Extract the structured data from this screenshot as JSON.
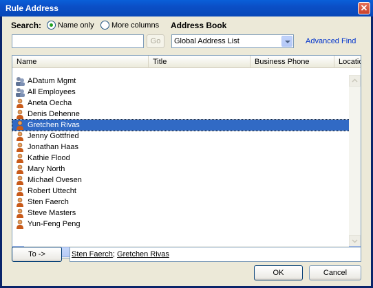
{
  "window": {
    "title": "Rule Address"
  },
  "search": {
    "label": "Search:",
    "options": [
      {
        "label": "Name only",
        "selected": true
      },
      {
        "label": "More columns",
        "selected": false
      }
    ],
    "input_value": "",
    "go_label": "Go"
  },
  "address_book": {
    "label": "Address Book",
    "selected": "Global Address List",
    "advanced_find": "Advanced Find"
  },
  "list": {
    "columns": [
      "Name",
      "Title",
      "Business Phone",
      "Locatio"
    ],
    "rows": [
      {
        "name": "ADatum Mgmt",
        "icon": "group-icon",
        "selected": false
      },
      {
        "name": "All Employees",
        "icon": "group-icon",
        "selected": false
      },
      {
        "name": "Aneta Oecha",
        "icon": "person-icon",
        "selected": false
      },
      {
        "name": "Denis Dehenne",
        "icon": "person-icon",
        "selected": false
      },
      {
        "name": "Gretchen Rivas",
        "icon": "person-icon",
        "selected": true
      },
      {
        "name": "Jenny Gottfried",
        "icon": "person-icon",
        "selected": false
      },
      {
        "name": "Jonathan Haas",
        "icon": "person-icon",
        "selected": false
      },
      {
        "name": "Kathie Flood",
        "icon": "person-icon",
        "selected": false
      },
      {
        "name": "Mary North",
        "icon": "person-icon",
        "selected": false
      },
      {
        "name": "Michael Ovesen",
        "icon": "person-icon",
        "selected": false
      },
      {
        "name": "Robert Uttecht",
        "icon": "person-icon",
        "selected": false
      },
      {
        "name": "Sten Faerch",
        "icon": "person-icon",
        "selected": false
      },
      {
        "name": "Steve Masters",
        "icon": "person-icon",
        "selected": false
      },
      {
        "name": "Yun-Feng Peng",
        "icon": "person-icon",
        "selected": false
      }
    ]
  },
  "recipients": {
    "to_button": "To ->",
    "names": [
      "Sten Faerch",
      "Gretchen Rivas"
    ],
    "separator": "; "
  },
  "footer": {
    "ok": "OK",
    "cancel": "Cancel"
  },
  "colors": {
    "title_bar": "#0A5FD8",
    "selection": "#316AC5",
    "link": "#0033CC"
  }
}
